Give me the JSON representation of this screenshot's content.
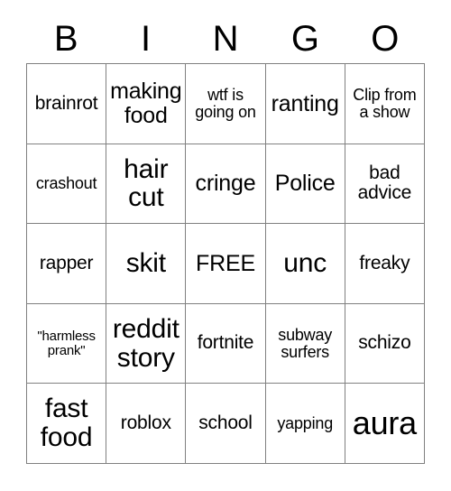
{
  "header": {
    "letters": [
      "B",
      "I",
      "N",
      "G",
      "O"
    ]
  },
  "grid": {
    "rows": 5,
    "columns": 5,
    "border_color": "#808080",
    "text_color": "#000000",
    "background_color": "#ffffff",
    "cells": [
      {
        "text": "brainrot",
        "size": "fs-m"
      },
      {
        "text": "making food",
        "size": "fs-l"
      },
      {
        "text": "wtf is going on",
        "size": "fs-s"
      },
      {
        "text": "ranting",
        "size": "fs-l"
      },
      {
        "text": "Clip from a show",
        "size": "fs-s"
      },
      {
        "text": "crashout",
        "size": "fs-s"
      },
      {
        "text": "hair cut",
        "size": "fs-xl"
      },
      {
        "text": "cringe",
        "size": "fs-l"
      },
      {
        "text": "Police",
        "size": "fs-l"
      },
      {
        "text": "bad advice",
        "size": "fs-m"
      },
      {
        "text": "rapper",
        "size": "fs-m"
      },
      {
        "text": "skit",
        "size": "fs-xl"
      },
      {
        "text": "FREE",
        "size": "fs-l"
      },
      {
        "text": "unc",
        "size": "fs-xl"
      },
      {
        "text": "freaky",
        "size": "fs-m"
      },
      {
        "text": "\"harmless prank\"",
        "size": "fs-xs"
      },
      {
        "text": "reddit story",
        "size": "fs-xl"
      },
      {
        "text": "fortnite",
        "size": "fs-m"
      },
      {
        "text": "subway surfers",
        "size": "fs-s"
      },
      {
        "text": "schizo",
        "size": "fs-m"
      },
      {
        "text": "fast food",
        "size": "fs-xl"
      },
      {
        "text": "roblox",
        "size": "fs-m"
      },
      {
        "text": "school",
        "size": "fs-m"
      },
      {
        "text": "yapping",
        "size": "fs-s"
      },
      {
        "text": "aura",
        "size": "fs-xxl"
      }
    ]
  }
}
